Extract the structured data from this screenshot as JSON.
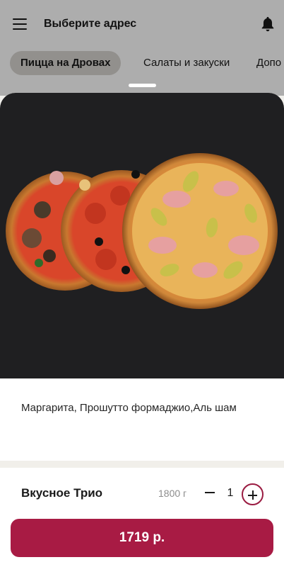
{
  "header": {
    "address_label": "Выберите адрес",
    "menu_icon": "hamburger-menu-icon",
    "bell_icon": "bell-icon"
  },
  "categories": [
    {
      "label": "Пицца на Дровах",
      "active": true
    },
    {
      "label": "Салаты и закуски",
      "active": false
    },
    {
      "label": "Допо",
      "active": false
    }
  ],
  "product": {
    "description": "Маргарита, Прошутто формаджио,Аль шам",
    "name": "Вкусное Трио",
    "weight": "1800 г",
    "quantity": "1",
    "price_label": "1719 р."
  },
  "colors": {
    "accent": "#a81b44",
    "plus_border": "#9a1b41",
    "photo_bg": "#1f1f21"
  }
}
